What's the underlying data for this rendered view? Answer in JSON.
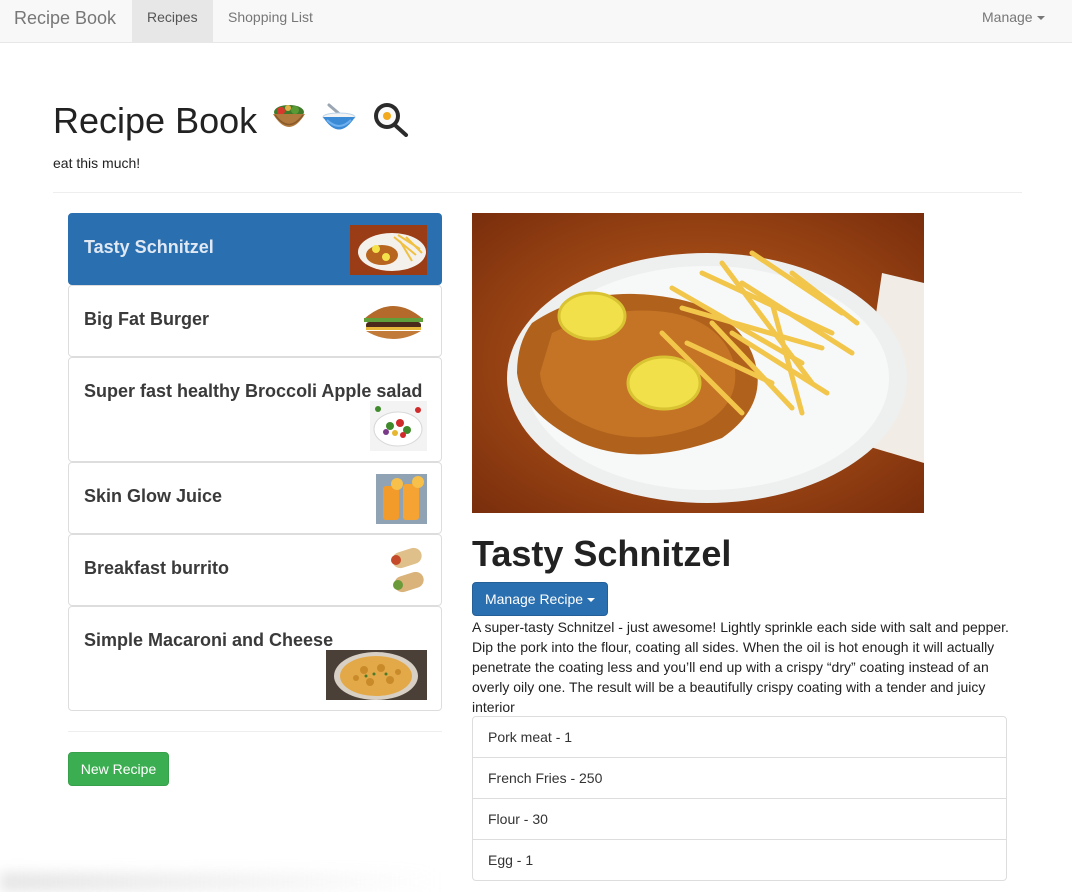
{
  "navbar": {
    "brand": "Recipe Book",
    "tabs": [
      {
        "label": "Recipes",
        "active": true
      },
      {
        "label": "Shopping List",
        "active": false
      }
    ],
    "manage_label": "Manage"
  },
  "header": {
    "title": "Recipe Book",
    "emojis": [
      "salad-bowl-icon",
      "bowl-spoon-icon",
      "frying-pan-egg-icon"
    ],
    "subtitle": "eat this much!"
  },
  "recipes": [
    {
      "name": "Tasty Schnitzel",
      "active": true,
      "thumb": "schnitzel-image"
    },
    {
      "name": "Big Fat Burger",
      "active": false,
      "thumb": "burger-image"
    },
    {
      "name": "Super fast healthy Broccoli Apple salad",
      "active": false,
      "thumb": "salad-image"
    },
    {
      "name": "Skin Glow Juice",
      "active": false,
      "thumb": "juice-image"
    },
    {
      "name": "Breakfast burrito",
      "active": false,
      "thumb": "burrito-image"
    },
    {
      "name": "Simple Macaroni and Cheese",
      "active": false,
      "thumb": "macaroni-image"
    }
  ],
  "new_recipe_label": "New Recipe",
  "detail": {
    "name": "Tasty Schnitzel",
    "manage_label": "Manage Recipe",
    "description": "A super-tasty Schnitzel - just awesome! Lightly sprinkle each side with salt and pepper. Dip the pork into the flour, coating all sides. When the oil is hot enough it will actually penetrate the coating less and you’ll end up with a crispy “dry” coating instead of an overly oily one. The result will be a beautifully crispy coating with a tender and juicy interior",
    "ingredients": [
      "Pork meat - 1",
      "French Fries - 250",
      "Flour - 30",
      "Egg - 1"
    ]
  },
  "colors": {
    "primary": "#2a6fb0",
    "success": "#3cae52",
    "navbar_bg": "#f8f8f8"
  }
}
